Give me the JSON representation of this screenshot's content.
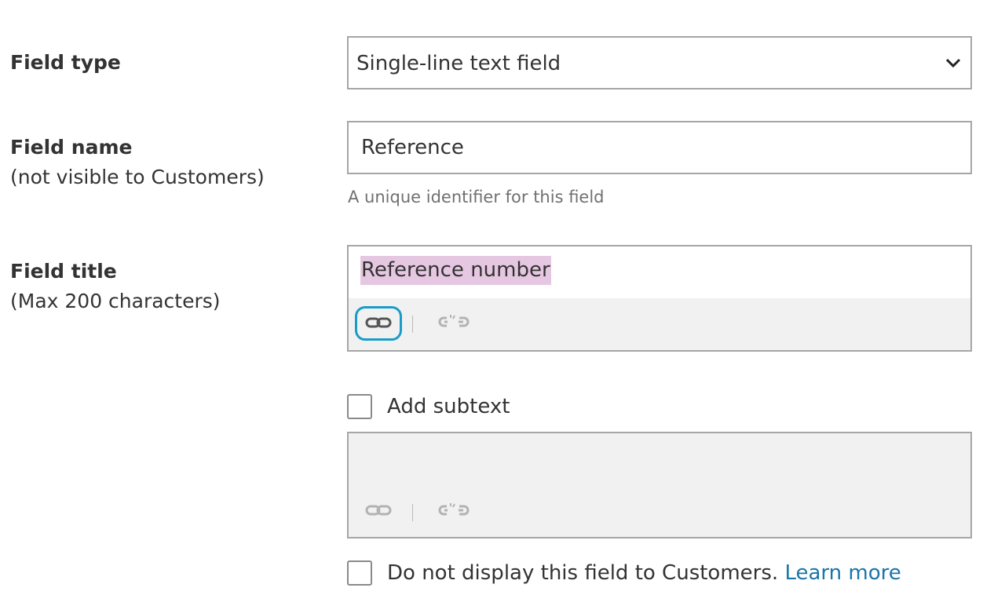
{
  "field_type": {
    "label": "Field type",
    "selected": "Single-line text field"
  },
  "field_name": {
    "label": "Field name",
    "sublabel": "(not visible to Customers)",
    "value": "Reference",
    "help": "A unique identifier for this field"
  },
  "field_title": {
    "label": "Field title",
    "sublabel": "(Max 200 characters)",
    "value": "Reference number"
  },
  "subtext": {
    "checkbox_label": "Add subtext"
  },
  "hide_field": {
    "checkbox_label": "Do not display this field to Customers.",
    "link_text": "Learn more"
  },
  "colors": {
    "focus_ring": "#1a9cc8",
    "selection": "#e6c7e1",
    "link": "#1b75a8",
    "toolbar_bg": "#f1f1f1"
  },
  "icons": {
    "link": "link-icon",
    "unlink": "unlink-icon",
    "dropdown": "chevron-down-icon"
  }
}
